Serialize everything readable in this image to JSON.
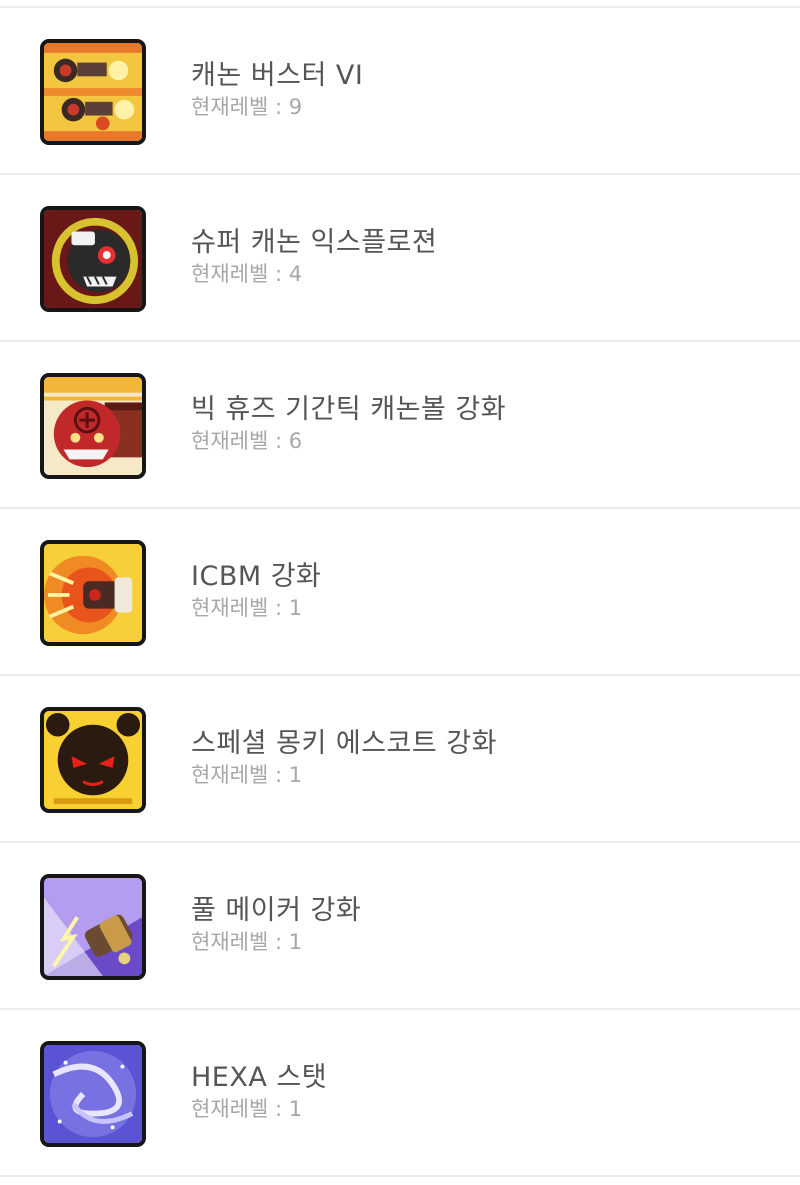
{
  "skills": [
    {
      "name": "캐논 버스터 VI",
      "level_text": "현재레벨 : 9",
      "icon": "cannon-buster-icon"
    },
    {
      "name": "슈퍼 캐논 익스플로젼",
      "level_text": "현재레벨 : 4",
      "icon": "super-cannon-explosion-icon"
    },
    {
      "name": "빅 휴즈 기간틱 캐논볼 강화",
      "level_text": "현재레벨 : 6",
      "icon": "big-huge-gigantic-cannonball-icon"
    },
    {
      "name": "ICBM 강화",
      "level_text": "현재레벨 : 1",
      "icon": "icbm-icon"
    },
    {
      "name": "스페셜 몽키 에스코트 강화",
      "level_text": "현재레벨 : 1",
      "icon": "special-monkey-escort-icon"
    },
    {
      "name": "풀 메이커 강화",
      "level_text": "현재레벨 : 1",
      "icon": "pool-maker-icon"
    },
    {
      "name": "HEXA 스탯",
      "level_text": "현재레벨 : 1",
      "icon": "hexa-stat-icon"
    }
  ],
  "colors": {
    "divider": "#ececec",
    "name_text": "#555555",
    "level_text": "#a7a7a7",
    "icon_border": "#161616"
  }
}
